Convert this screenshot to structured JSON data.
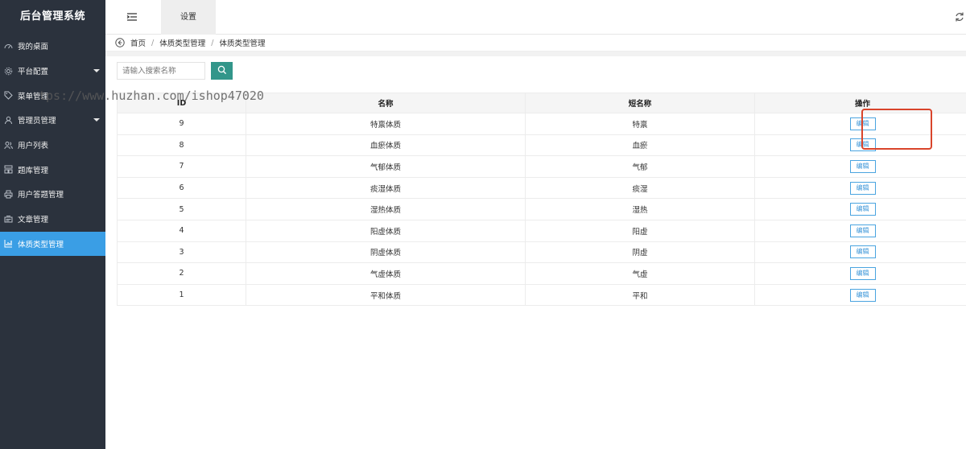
{
  "brand": "后台管理系统",
  "sidebar": {
    "items": [
      {
        "label": "我的桌面",
        "icon": "dashboard-icon",
        "caret": false,
        "active": false
      },
      {
        "label": "平台配置",
        "icon": "gear-icon",
        "caret": true,
        "active": false
      },
      {
        "label": "菜单管理",
        "icon": "tag-icon",
        "caret": false,
        "active": false
      },
      {
        "label": "管理员管理",
        "icon": "user-icon",
        "caret": true,
        "active": false
      },
      {
        "label": "用户列表",
        "icon": "users-icon",
        "caret": false,
        "active": false
      },
      {
        "label": "题库管理",
        "icon": "grid-icon",
        "caret": false,
        "active": false
      },
      {
        "label": "用户答题管理",
        "icon": "printer-icon",
        "caret": false,
        "active": false
      },
      {
        "label": "文章管理",
        "icon": "document-icon",
        "caret": false,
        "active": false
      },
      {
        "label": "体质类型管理",
        "icon": "chart-icon",
        "caret": false,
        "active": true
      }
    ]
  },
  "topbar": {
    "tab_label": "设置"
  },
  "breadcrumb": [
    "首页",
    "体质类型管理",
    "体质类型管理"
  ],
  "search": {
    "placeholder": "请输入搜索名称",
    "value": ""
  },
  "table": {
    "headers": [
      "ID",
      "名称",
      "短名称",
      "操作"
    ],
    "edit_label": "编辑",
    "rows": [
      {
        "id": "9",
        "name": "特禀体质",
        "short": "特禀"
      },
      {
        "id": "8",
        "name": "血瘀体质",
        "short": "血瘀"
      },
      {
        "id": "7",
        "name": "气郁体质",
        "short": "气郁"
      },
      {
        "id": "6",
        "name": "痰湿体质",
        "short": "痰湿"
      },
      {
        "id": "5",
        "name": "湿热体质",
        "short": "湿热"
      },
      {
        "id": "4",
        "name": "阳虚体质",
        "short": "阳虚"
      },
      {
        "id": "3",
        "name": "阴虚体质",
        "short": "阴虚"
      },
      {
        "id": "2",
        "name": "气虚体质",
        "short": "气虚"
      },
      {
        "id": "1",
        "name": "平和体质",
        "short": "平和"
      }
    ]
  },
  "watermark": "tps://www.huzhan.com/ishop47020",
  "colors": {
    "sidebar_bg": "#2b323d",
    "active": "#3a9ee5",
    "search_button": "#32968a",
    "edit_border": "#4aa4e0",
    "annotation": "#d9442b"
  }
}
